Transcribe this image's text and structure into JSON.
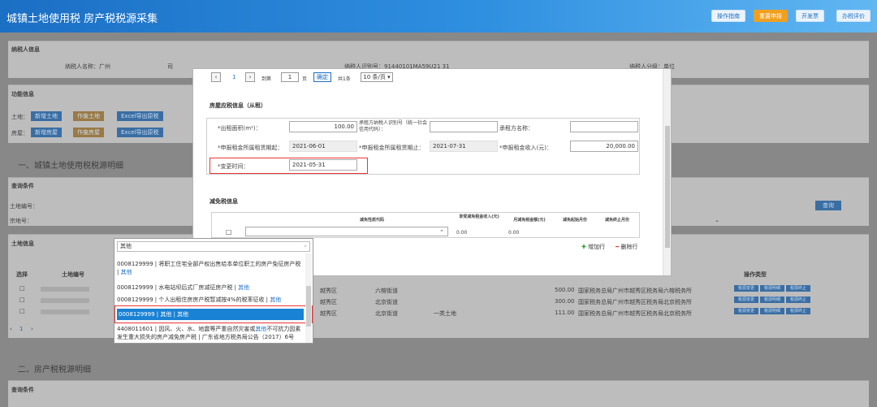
{
  "header": {
    "title": "城镇土地使用税 房产税税源采集",
    "buttons": [
      "操作指南",
      "重置申报",
      "开发票",
      "办税评价"
    ]
  },
  "background": {
    "taxpayer_section": "纳税人信息",
    "taxpayer_name_label": "纳税人名称：广州",
    "taxpayer_name_suffix": "司",
    "taxpayer_id_label": "纳税人识别号：91440101MA59U21 31",
    "taxpayer_type": "纳税人分级：单位",
    "function_section": "功能信息",
    "land_label": "土地：",
    "house_label": "房屋：",
    "land_buttons": [
      "新增土地",
      "作废土地",
      "Excel导出原税"
    ],
    "house_buttons": [
      "新增房屋",
      "作废房屋",
      "Excel导出原税"
    ],
    "sect1": "一、城镇土地使用税税源明细",
    "query_cond": "查询条件",
    "land_no_label": "土地编号：",
    "street_label": "宗地号：",
    "query_btn": "查询",
    "land_info": "土地信息",
    "col_select": "选择",
    "col_land_no": "土地编号",
    "col_ops": "操作类型",
    "rows": [
      {
        "district": "越秀区",
        "street": "六榕街道",
        "amount": "500.00",
        "note": "国家税务总局广州市越秀区税务局六榕税务所",
        "use": ""
      },
      {
        "district": "越秀区",
        "street": "北京街道",
        "amount": "300.00",
        "note": "国家税务总局广州市越秀区税务局北京税务所",
        "use": ""
      },
      {
        "district": "越秀区",
        "street": "北京街道",
        "amount": "111.00",
        "note": "国家税务总局广州市越秀区税务局北京税务所",
        "use": "一类土地"
      }
    ],
    "row_ops": [
      "税源变更",
      "税源明细",
      "税源终止"
    ],
    "pager": "1",
    "sect2": "二、房产税税源明细",
    "query_cond2": "查询条件"
  },
  "modal": {
    "pager": {
      "page": "1",
      "goto_label": "到第",
      "page_input": "1",
      "page_suffix": "页",
      "confirm": "确定",
      "total": "共1条",
      "per_page": "10 条/页"
    },
    "rent_section": "房屋应税信息（从租）",
    "rent_area_label": "*出租面积(m²)：",
    "rent_area_value": "100.00",
    "lessee_id_label": "承租方纳税人识别号（统一社会信用代码）：",
    "lessee_name_label": "承租方名称：",
    "rent_start_label": "*申报租金所属租赁期起：",
    "rent_start_value": "2021-06-01",
    "rent_end_label": "*申报租金所属租赁期止：",
    "rent_end_value": "2021-07-31",
    "rent_income_label": "*申报租金收入(元)：",
    "rent_income_value": "20,000.00",
    "change_time_label": "*变更时间：",
    "change_time_value": "2021-05-31",
    "relief_section": "减免税信息",
    "relief_cols": [
      "减免性质代码",
      "享受减免租金收入(元)",
      "月减免税金额(元)",
      "减免起始月份",
      "减免终止月份"
    ],
    "relief_row": {
      "amount1": "0.00",
      "amount2": "0.00"
    },
    "add_row": "增加行",
    "del_row": "删除行"
  },
  "dropdown": {
    "search": "其他",
    "items": [
      {
        "code": "0008129999 | 将职工住宅全部产权出售给本单位职工的房产免征房产税 | ",
        "tag": "其他",
        "selected": false
      },
      {
        "code": "0008129999 | 水电站坝后式厂房减征房产税 | ",
        "tag": "其他",
        "selected": false
      },
      {
        "code": "0008129999 | 个人出租住房房产税暂减按4%的税率征收 | ",
        "tag": "其他",
        "selected": false
      },
      {
        "code": "0008129999 | 其他 | 其他",
        "tag": "",
        "selected": true
      },
      {
        "code": "4408011601 | 因风、火、水、地震等严重自然灾害或",
        "tag": "其他",
        "tail": "不可抗力因素发生重大损失的房产减免房产税 | 广东省地方税务局公告（2017）6号",
        "selected": false
      }
    ]
  }
}
